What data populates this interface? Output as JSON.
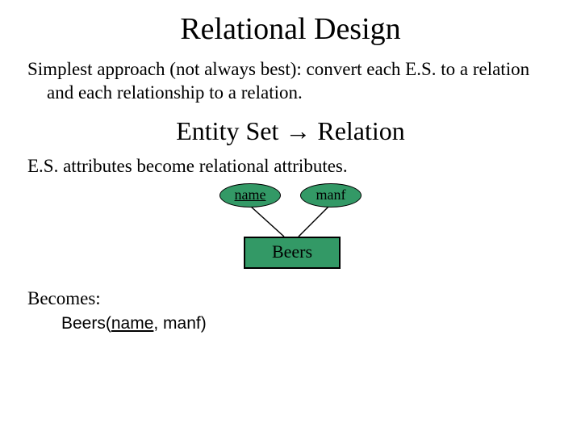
{
  "title": "Relational Design",
  "intro": "Simplest approach (not always best): convert each E.S. to a relation and each relationship to a relation.",
  "subheading_left": "Entity Set ",
  "subheading_arrow": "→",
  "subheading_right": " Relation",
  "attr_line": "E.S. attributes become relational attributes.",
  "diagram": {
    "attr1": "name",
    "attr2": "manf",
    "entity": "Beers"
  },
  "becomes": "Becomes:",
  "schema_rel": "Beers(",
  "schema_pk": "name",
  "schema_rest": ", manf)"
}
